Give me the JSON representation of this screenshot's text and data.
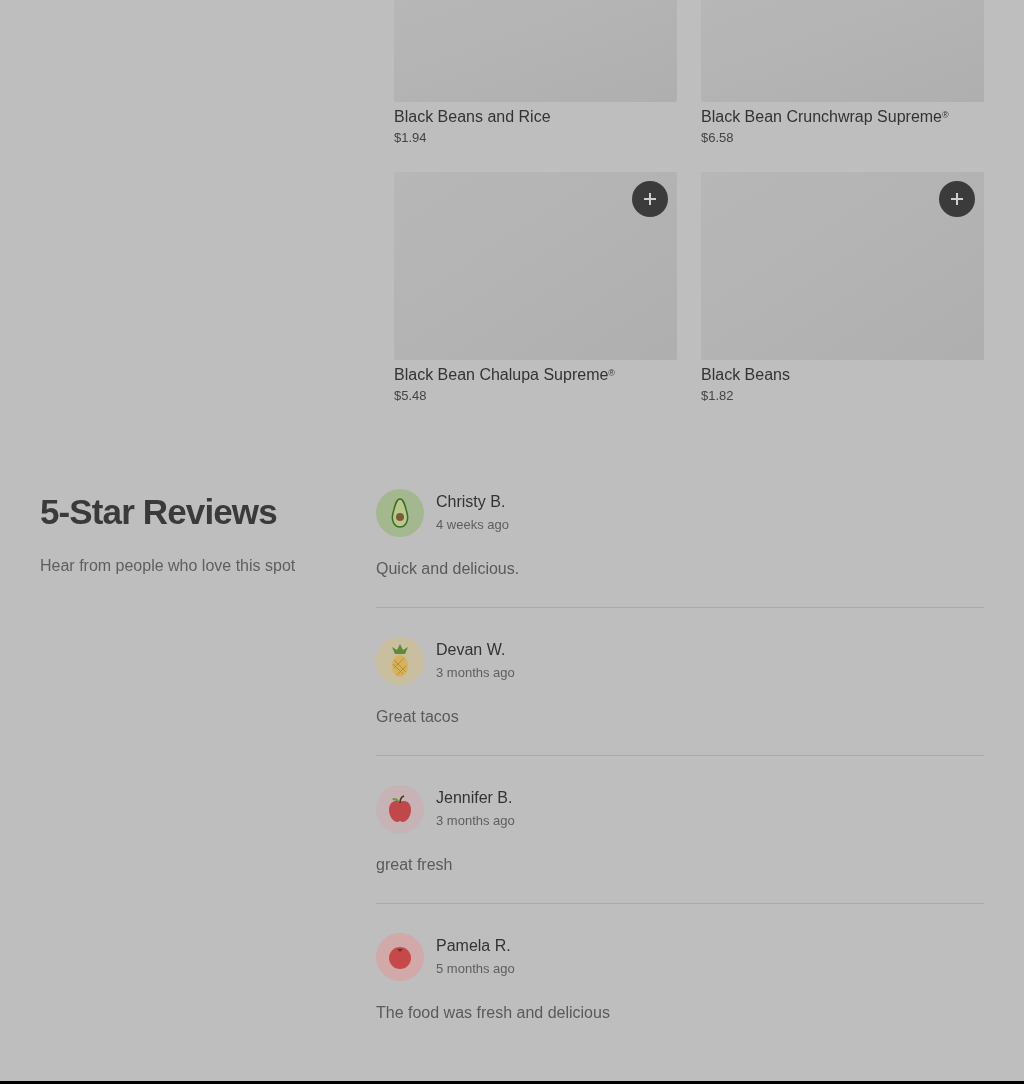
{
  "menu_rows": [
    {
      "cropped": true,
      "items": [
        {
          "name": "Black Beans and Rice",
          "price": "$1.94"
        },
        {
          "name": "Black Bean Crunchwrap Supreme$^{®}$",
          "price": "$6.58"
        }
      ]
    },
    {
      "cropped": false,
      "items": [
        {
          "name": "Black Bean Chalupa Supreme$^{®}$",
          "price": "$5.48"
        },
        {
          "name": "Black Beans",
          "price": "$1.82"
        }
      ]
    }
  ],
  "reviews_section": {
    "title": "5-Star Reviews",
    "subtitle": "Hear from people who love this spot",
    "reviews": [
      {
        "avatar": {
          "kind": "avocado",
          "color": "#a3b88f"
        },
        "name": "Christy B.",
        "time": "4 weeks ago",
        "text": "Quick and delicious."
      },
      {
        "avatar": {
          "kind": "pineapple",
          "color": "#c9bf9f"
        },
        "name": "Devan W.",
        "time": "3 months ago",
        "text": "Great tacos"
      },
      {
        "avatar": {
          "kind": "apple",
          "color": "#c7b3b5"
        },
        "name": "Jennifer B.",
        "time": "3 months ago",
        "text": "great fresh"
      },
      {
        "avatar": {
          "kind": "tomato",
          "color": "#d1a9a9"
        },
        "name": "Pamela R.",
        "time": "5 months ago",
        "text": "The food was fresh and delicious"
      }
    ]
  }
}
